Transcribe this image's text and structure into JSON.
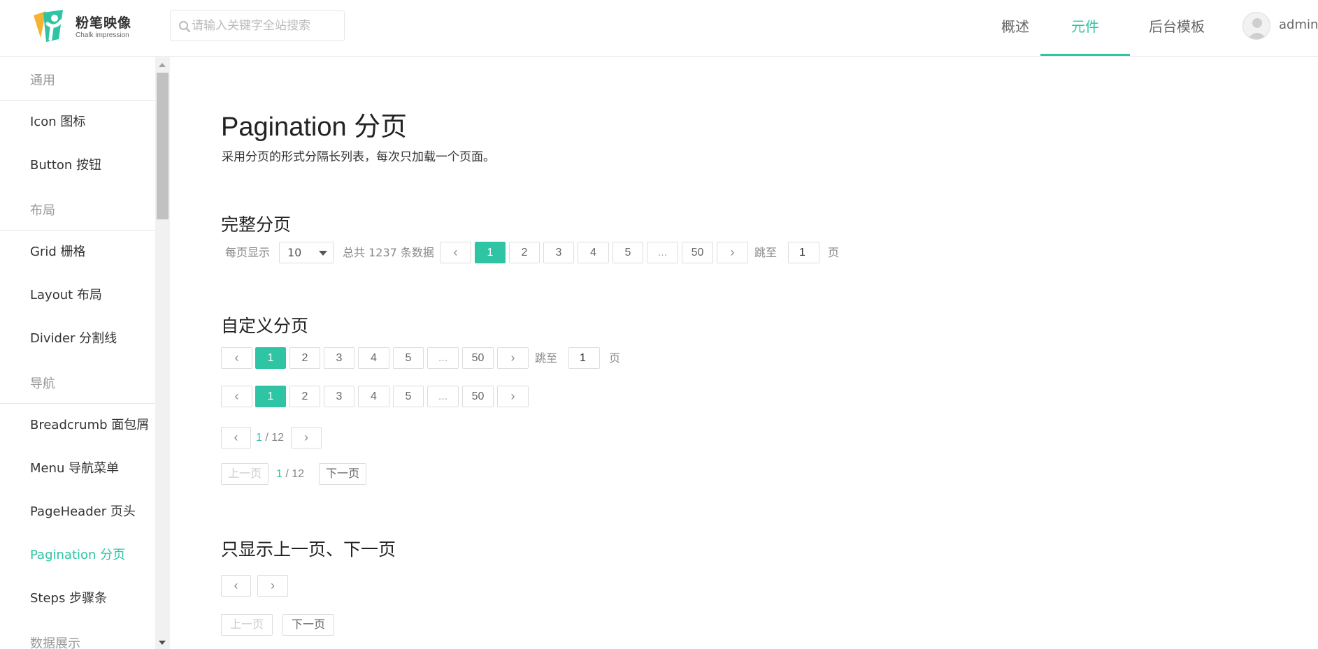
{
  "header": {
    "logo_title": "粉笔映像",
    "logo_subtitle": "Chalk impression",
    "search_placeholder": "请输入关键字全站搜索",
    "nav": [
      {
        "label": "概述"
      },
      {
        "label": "元件",
        "active": true
      },
      {
        "label": "后台模板"
      }
    ],
    "username": "admin"
  },
  "sidebar": {
    "items": [
      {
        "label": "通用",
        "type": "group"
      },
      {
        "label": "Icon 图标"
      },
      {
        "label": "Button 按钮"
      },
      {
        "label": "布局",
        "type": "group"
      },
      {
        "label": "Grid 栅格"
      },
      {
        "label": "Layout 布局"
      },
      {
        "label": "Divider 分割线"
      },
      {
        "label": "导航",
        "type": "group"
      },
      {
        "label": "Breadcrumb 面包屑"
      },
      {
        "label": "Menu 导航菜单"
      },
      {
        "label": "PageHeader 页头"
      },
      {
        "label": "Pagination 分页",
        "active": true
      },
      {
        "label": "Steps 步骤条"
      },
      {
        "label": "数据展示",
        "type": "group"
      }
    ]
  },
  "main": {
    "title": "Pagination 分页",
    "description": "采用分页的形式分隔长列表，每次只加载一个页面。",
    "sections": {
      "full": {
        "title": "完整分页",
        "page_size_label": "每页显示",
        "page_size_value": "10",
        "total_text": "总共 1237 条数据",
        "pages": [
          "1",
          "2",
          "3",
          "4",
          "5",
          "...",
          "50"
        ],
        "current_page": "1",
        "jump_label": "跳至",
        "jump_value": "1",
        "jump_suffix": "页"
      },
      "custom": {
        "title": "自定义分页",
        "pages": [
          "1",
          "2",
          "3",
          "4",
          "5",
          "...",
          "50"
        ],
        "current_page": "1",
        "jump_label": "跳至",
        "jump_value": "1",
        "jump_suffix": "页",
        "simple_current": "1",
        "simple_total": "/ 12",
        "prev_text": "上一页",
        "next_text": "下一页"
      },
      "prev_next": {
        "title": "只显示上一页、下一页",
        "prev_text": "上一页",
        "next_text": "下一页"
      }
    },
    "icons": {
      "prev": "‹",
      "next": "›"
    }
  },
  "colors": {
    "accent": "#2ec4a4",
    "border": "#dddddd",
    "muted": "#888888"
  }
}
